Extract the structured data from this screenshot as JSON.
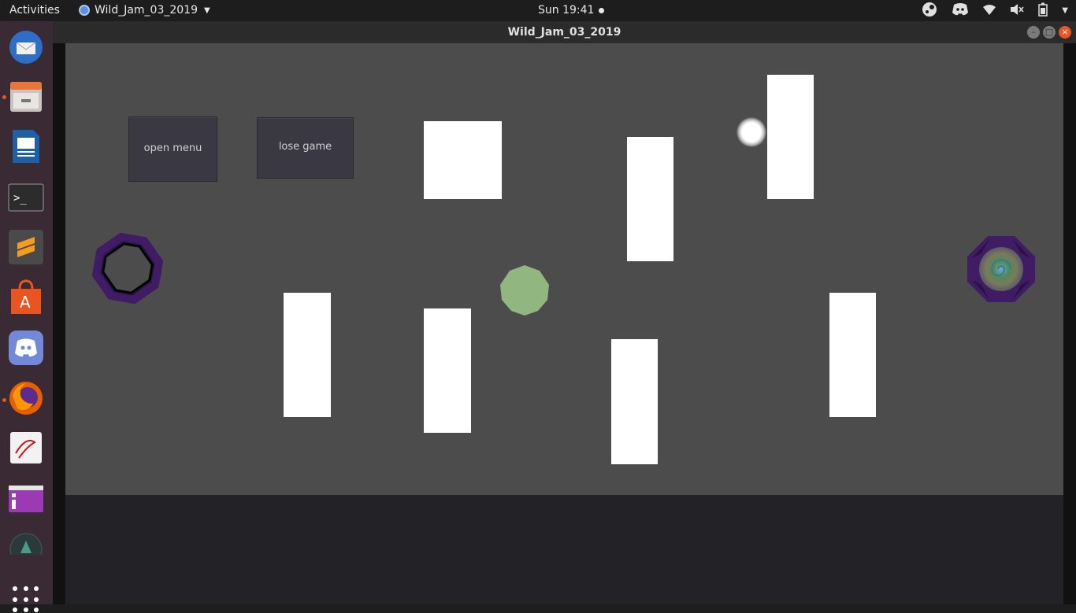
{
  "topbar": {
    "activities": "Activities",
    "app_name": "Wild_Jam_03_2019",
    "clock": "Sun 19:41"
  },
  "tray_icons": [
    "steam-icon",
    "discord-icon",
    "wifi-icon",
    "volume-muted-icon",
    "battery-icon",
    "system-menu-icon"
  ],
  "dock": {
    "items": [
      "thunderbird",
      "files",
      "libreoffice-writer",
      "terminal",
      "sublime-text",
      "ubuntu-software",
      "discord",
      "firefox",
      "document-viewer",
      "app-window",
      "app-partial"
    ],
    "running": [
      "files",
      "firefox"
    ]
  },
  "window": {
    "title": "Wild_Jam_03_2019"
  },
  "game": {
    "buttons": {
      "open_menu": "open menu",
      "lose_game": "lose game"
    },
    "colors": {
      "background": "#4c4c4c",
      "wall": "#ffffff",
      "player": "#91b67f",
      "portal": "#3f1c63",
      "bottom_panel": "#232227"
    }
  }
}
